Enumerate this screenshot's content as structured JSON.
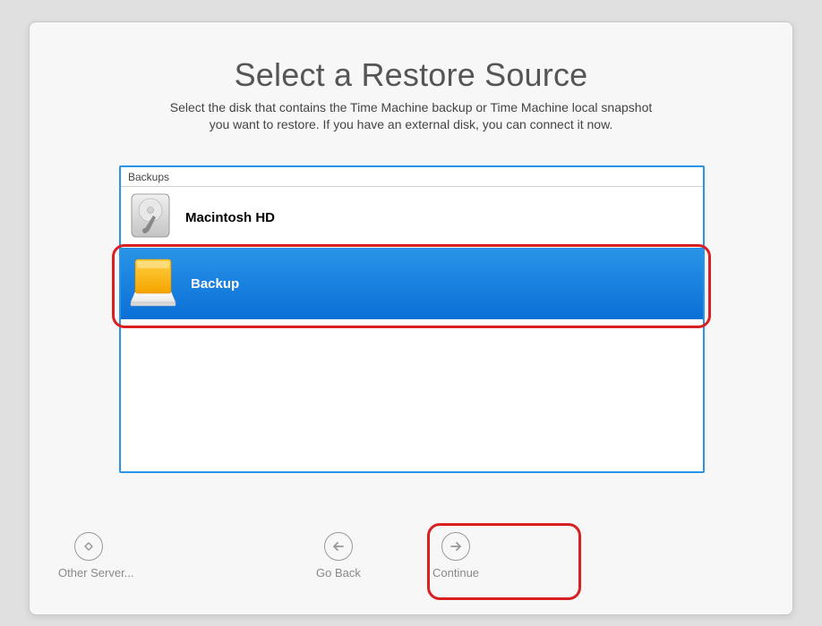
{
  "header": {
    "title": "Select a Restore Source",
    "subtitle_line1": "Select the disk that contains the Time Machine backup or Time Machine local snapshot",
    "subtitle_line2": "you want to restore. If you have an external disk, you can connect it now."
  },
  "list": {
    "header": "Backups",
    "items": [
      {
        "label": "Macintosh HD",
        "icon": "internal-disk-icon",
        "selected": false
      },
      {
        "label": "Backup",
        "icon": "external-disk-icon",
        "selected": true
      }
    ]
  },
  "buttons": {
    "other_server": "Other Server...",
    "go_back": "Go Back",
    "continue": "Continue"
  }
}
